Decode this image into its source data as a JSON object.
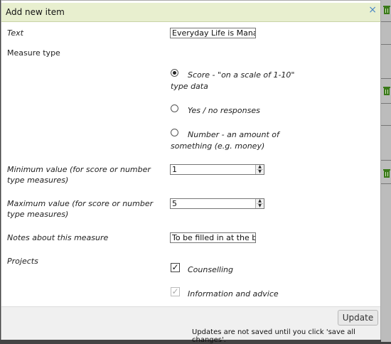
{
  "dialog": {
    "title": "Add new item",
    "close_label": "×"
  },
  "form": {
    "text_label": "Text",
    "text_value": "Everyday Life is Manag",
    "measure_type_label": "Measure type",
    "measure_options": [
      {
        "label": "Score - \"on a scale of 1-10\" type data",
        "selected": true
      },
      {
        "label": "Yes / no responses",
        "selected": false
      },
      {
        "label": "Number - an amount of something (e.g. money)",
        "selected": false
      }
    ],
    "min_label": "Minimum value (for score or number type measures)",
    "min_value": "1",
    "max_label": "Maximum value (for score or number type measures)",
    "max_value": "5",
    "notes_label": "Notes about this measure",
    "notes_value": "To be filled in at the be",
    "projects_label": "Projects",
    "projects": [
      {
        "label": "Counselling",
        "checked": true,
        "disabled": false
      },
      {
        "label": "Information and advice",
        "checked": true,
        "disabled": true
      }
    ]
  },
  "footer": {
    "update_label": "Update",
    "note": "Updates are not saved until you click 'save all changes'."
  },
  "icons": {
    "close": "close-icon",
    "trash": "trash-icon",
    "spinner_up": "chevron-up-icon",
    "spinner_down": "chevron-down-icon"
  },
  "colors": {
    "titlebar_bg": "#e8efcf",
    "close_icon": "#4a87c5",
    "background_trash": "#3a7a1a"
  }
}
